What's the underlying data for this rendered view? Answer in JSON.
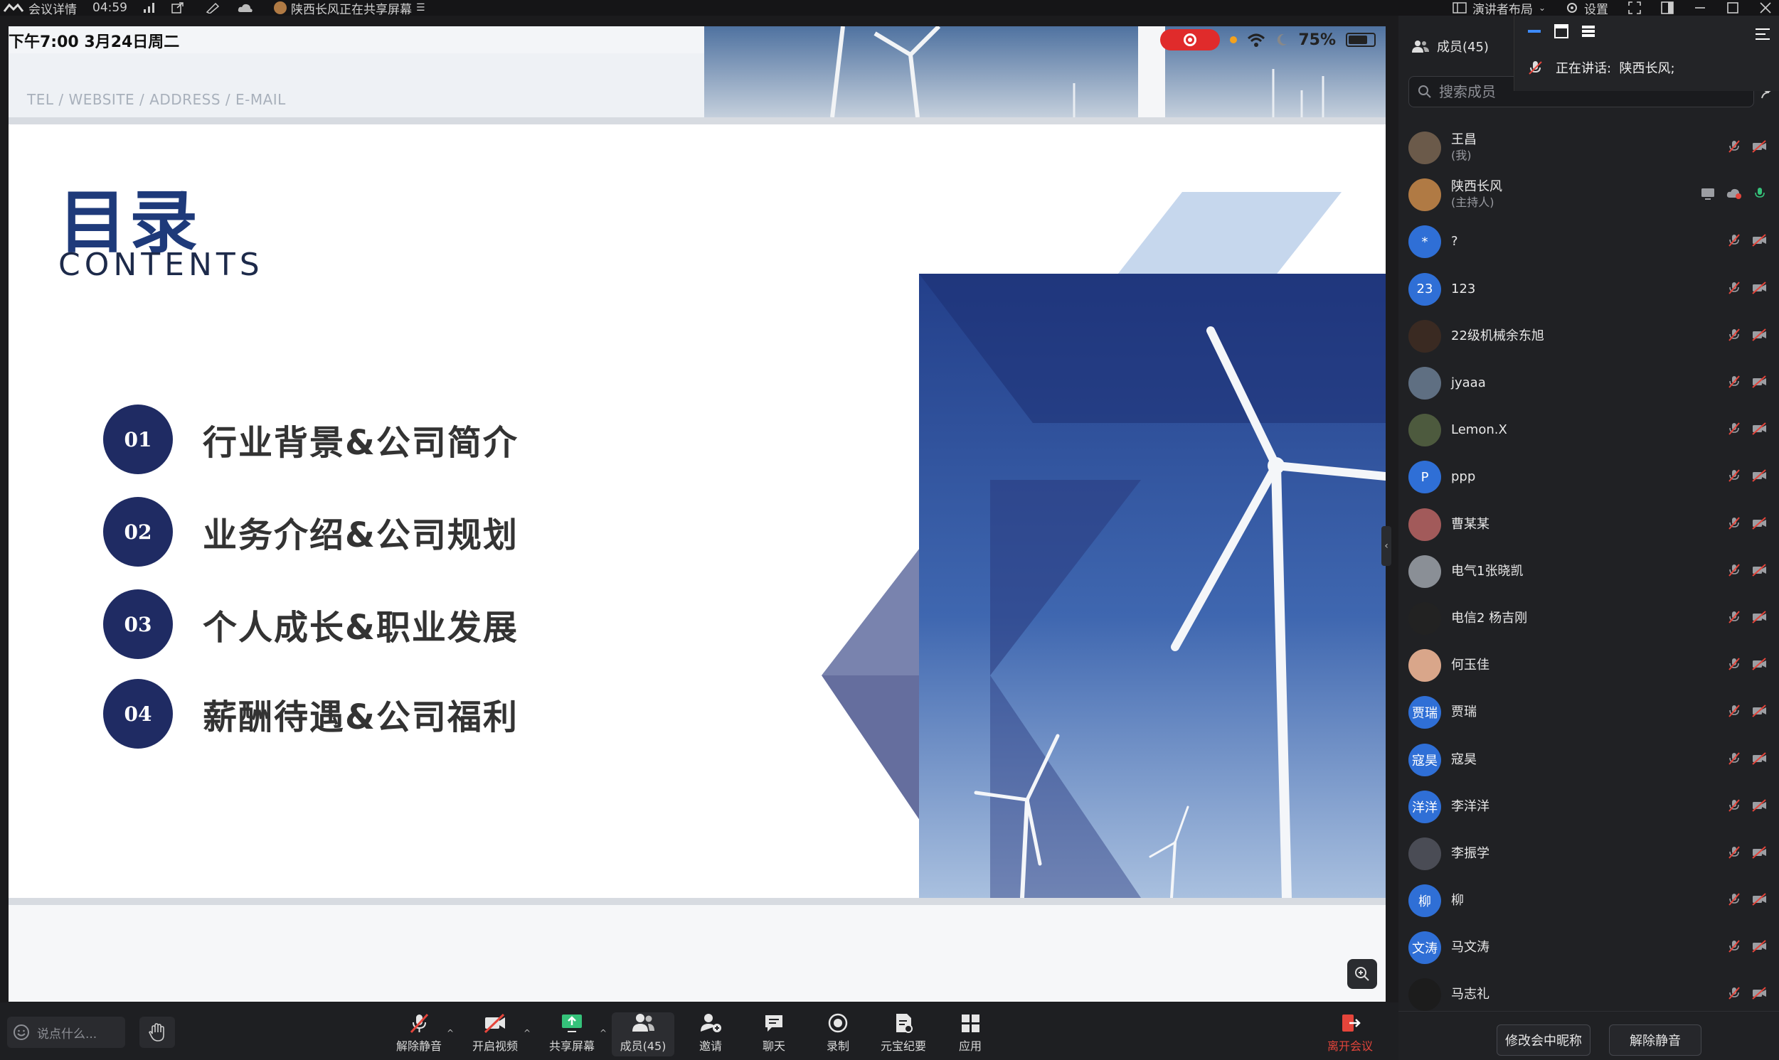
{
  "topbar": {
    "meeting_details": "会议详情",
    "elapsed": "04:59",
    "sharing_notice": "陕西长风正在共享屏幕",
    "layout_label": "演讲者布局",
    "settings_label": "设置"
  },
  "shared": {
    "time_date": "下午7:00   3月24日周二",
    "battery": "75%",
    "contact_line": "TEL / WEBSITE / ADDRESS / E-MAIL",
    "title_cn": "目录",
    "title_en": "CONTENTS",
    "toc": [
      {
        "num": "01",
        "text": "行业背景&公司简介"
      },
      {
        "num": "02",
        "text": "业务介绍&公司规划"
      },
      {
        "num": "03",
        "text": "个人成长&职业发展"
      },
      {
        "num": "04",
        "text": "薪酬待遇&公司福利"
      }
    ]
  },
  "panel": {
    "title": "成员(45)",
    "search_placeholder": "搜索成员",
    "speaking_label": "正在讲话:",
    "speaking_name": "陕西长风;",
    "members": [
      {
        "name": "王昌",
        "sub": "(我)",
        "avatar": "",
        "color": "#6b5a4a"
      },
      {
        "name": "陕西长风",
        "sub": "(主持人)",
        "avatar": "",
        "color": "#b07a44"
      },
      {
        "name": "?",
        "sub": "",
        "avatar": "*",
        "color": "#2f6fd6"
      },
      {
        "name": "123",
        "sub": "",
        "avatar": "23",
        "color": "#2f6fd6"
      },
      {
        "name": "22级机械余东旭",
        "sub": "",
        "avatar": "",
        "color": "#3a2a22"
      },
      {
        "name": "jyaaa",
        "sub": "",
        "avatar": "",
        "color": "#5f6f82"
      },
      {
        "name": "Lemon.X",
        "sub": "",
        "avatar": "",
        "color": "#4d5a3e"
      },
      {
        "name": "ppp",
        "sub": "",
        "avatar": "P",
        "color": "#2f6fd6"
      },
      {
        "name": "曹某某",
        "sub": "",
        "avatar": "",
        "color": "#a25a5a"
      },
      {
        "name": "电气1张晓凯",
        "sub": "",
        "avatar": "",
        "color": "#8a8f96"
      },
      {
        "name": "电信2  杨吉刚",
        "sub": "",
        "avatar": "",
        "color": "#222"
      },
      {
        "name": "何玉佳",
        "sub": "",
        "avatar": "",
        "color": "#d9a68a"
      },
      {
        "name": "贾瑞",
        "sub": "",
        "avatar": "贾瑞",
        "color": "#2f6fd6"
      },
      {
        "name": "寇昊",
        "sub": "",
        "avatar": "寇昊",
        "color": "#2f6fd6"
      },
      {
        "name": "李洋洋",
        "sub": "",
        "avatar": "洋洋",
        "color": "#2f6fd6"
      },
      {
        "name": "李振学",
        "sub": "",
        "avatar": "",
        "color": "#4a4c55"
      },
      {
        "name": "柳",
        "sub": "",
        "avatar": "柳",
        "color": "#2f6fd6"
      },
      {
        "name": "马文涛",
        "sub": "",
        "avatar": "文涛",
        "color": "#2f6fd6"
      },
      {
        "name": "马志礼",
        "sub": "",
        "avatar": "",
        "color": "#1c1c1c"
      }
    ],
    "rename_btn": "修改会中昵称",
    "unmute_btn": "解除静音"
  },
  "toolbar": {
    "chat_placeholder": "说点什么...",
    "unmute": "解除静音",
    "video": "开启视频",
    "share": "共享屏幕",
    "members": "成员(45)",
    "invite": "邀请",
    "chat": "聊天",
    "record": "录制",
    "minutes": "元宝纪要",
    "apps": "应用",
    "leave": "离开会议"
  },
  "colors": {
    "accent": "#2f6fd6",
    "slide_navy": "#1f2b63",
    "leave_red": "#e5453b"
  }
}
